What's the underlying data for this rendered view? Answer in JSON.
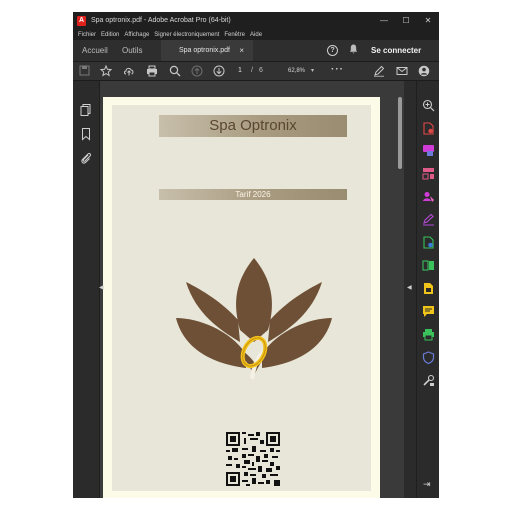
{
  "window": {
    "title": "Spa optronix.pdf - Adobe Acrobat Pro (64-bit)",
    "app_icon": "acrobat-icon",
    "controls": [
      "—",
      "☐",
      "✕"
    ]
  },
  "menu": [
    "Fichier",
    "Edition",
    "Affichage",
    "Signer électroniquement",
    "Fenêtre",
    "Aide"
  ],
  "tabs": {
    "home": "Accueil",
    "tools": "Outils",
    "document": "Spa optronix.pdf",
    "close": "×",
    "sign_in": "Se connecter"
  },
  "toolbar": {
    "page_current": "1",
    "page_separator": "/",
    "page_total": "6",
    "zoom": "62,8%",
    "zoom_caret": "▾",
    "more": "···"
  },
  "document": {
    "title": "Spa Optronix",
    "tarif": "Tarif 2026"
  },
  "colors": {
    "window_bg": "#2b2b2b",
    "titlebar_bg": "#1f1f1f",
    "page_bg": "#fbfbe8",
    "lotus_brown": "#6e5036",
    "ring_gold": "#f2c21a",
    "accent_magenta": "#d13bd8",
    "accent_green": "#3ac15b",
    "accent_yellow": "#f0c419",
    "accent_red": "#e04848"
  },
  "icons": {
    "left_panel": [
      "pages-icon",
      "bookmark-icon",
      "attachment-icon"
    ],
    "right_panel": [
      "zoom-icon",
      "export-pdf-icon",
      "create-pdf-icon",
      "edit-pdf-icon",
      "comment-icon",
      "fill-sign-icon",
      "send-for-review-icon",
      "compress-icon",
      "organize-pages-icon",
      "annotation-icon",
      "print-production-icon",
      "protect-icon",
      "more-tools-icon"
    ]
  },
  "collapse_left": "◀",
  "collapse_right": "◀",
  "expand_panel": "⇥"
}
